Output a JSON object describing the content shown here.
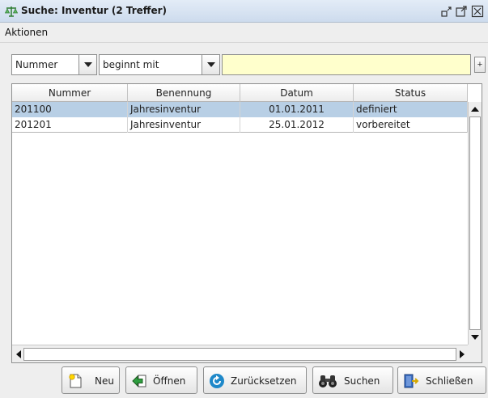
{
  "window": {
    "title": "Suche: Inventur (2 Treffer)",
    "icons": [
      "scales-icon",
      "minimize-icon",
      "maximize-icon",
      "close-icon"
    ]
  },
  "menubar": {
    "items": [
      {
        "label": "Aktionen"
      }
    ]
  },
  "filter": {
    "field": {
      "value": "Nummer",
      "icon": "chevron-down-icon"
    },
    "operator": {
      "value": "beginnt mit",
      "icon": "chevron-down-icon"
    },
    "search": {
      "value": "",
      "placeholder": ""
    },
    "add_label": "+"
  },
  "table": {
    "columns": [
      "Nummer",
      "Benennung",
      "Datum",
      "Status"
    ],
    "rows": [
      {
        "nummer": "201100",
        "benennung": "Jahresinventur",
        "datum": "01.01.2011",
        "status": "definiert",
        "selected": true
      },
      {
        "nummer": "201201",
        "benennung": "Jahresinventur",
        "datum": "25.01.2012",
        "status": "vorbereitet",
        "selected": false
      }
    ]
  },
  "buttons": {
    "neu": {
      "label": "Neu",
      "icon": "new-document-icon"
    },
    "oeffnen": {
      "label": "Öffnen",
      "icon": "open-arrow-icon"
    },
    "zuruecksetzen": {
      "label": "Zurücksetzen",
      "icon": "reset-icon"
    },
    "suchen": {
      "label": "Suchen",
      "icon": "binoculars-icon"
    },
    "schliessen": {
      "label": "Schließen",
      "icon": "exit-door-icon"
    }
  },
  "colors": {
    "selection": "#b8cfe5",
    "search_field": "#ffffcc",
    "titlebar": "#cddbed"
  }
}
